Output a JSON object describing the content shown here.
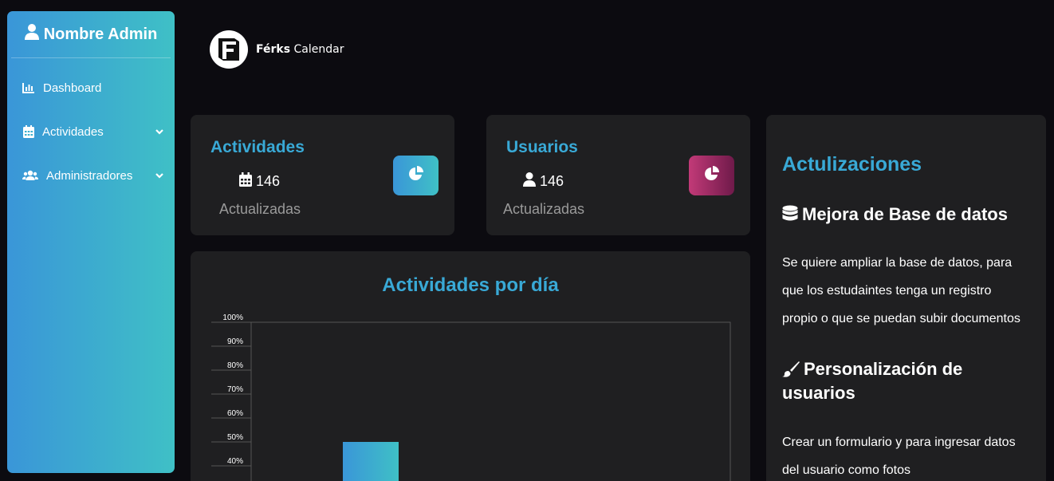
{
  "sidebar": {
    "admin_name": "Nombre Admin",
    "items": [
      {
        "label": "Dashboard",
        "icon": "chart-icon"
      },
      {
        "label": "Actividades",
        "icon": "calendar-icon",
        "expandable": true
      },
      {
        "label": "Administradores",
        "icon": "users-icon",
        "expandable": true
      }
    ]
  },
  "logo": {
    "brand": "Férks",
    "product": "Calendar"
  },
  "stats": {
    "activities": {
      "title": "Actividades",
      "count": "146",
      "sub": "Actualizadas",
      "color": "#3a9fd8"
    },
    "users": {
      "title": "Usuarios",
      "count": "146",
      "sub": "Actualizadas",
      "color": "#b0306e"
    }
  },
  "chart": {
    "title": "Actividades por día",
    "chart_data": {
      "type": "bar",
      "title": "Actividades por día",
      "yticks": [
        "100%",
        "90%",
        "80%",
        "70%",
        "60%",
        "50%",
        "40%"
      ],
      "ylim": [
        0,
        100
      ],
      "values": [
        50
      ],
      "grid": false
    }
  },
  "updates": {
    "title": "Actulizaciones",
    "items": [
      {
        "heading": "Mejora de Base de datos",
        "icon": "database-icon",
        "lines": [
          "Se quiere ampliar la base de datos, para",
          "que los estudaintes tenga un registro",
          "propio o que se puedan subir documentos"
        ]
      },
      {
        "heading_lines": [
          "Personalización de",
          "usuarios"
        ],
        "icon": "paintbrush-icon",
        "lines": [
          "Crear un formulario y para ingresar datos",
          "del usuario como fotos"
        ]
      }
    ]
  }
}
